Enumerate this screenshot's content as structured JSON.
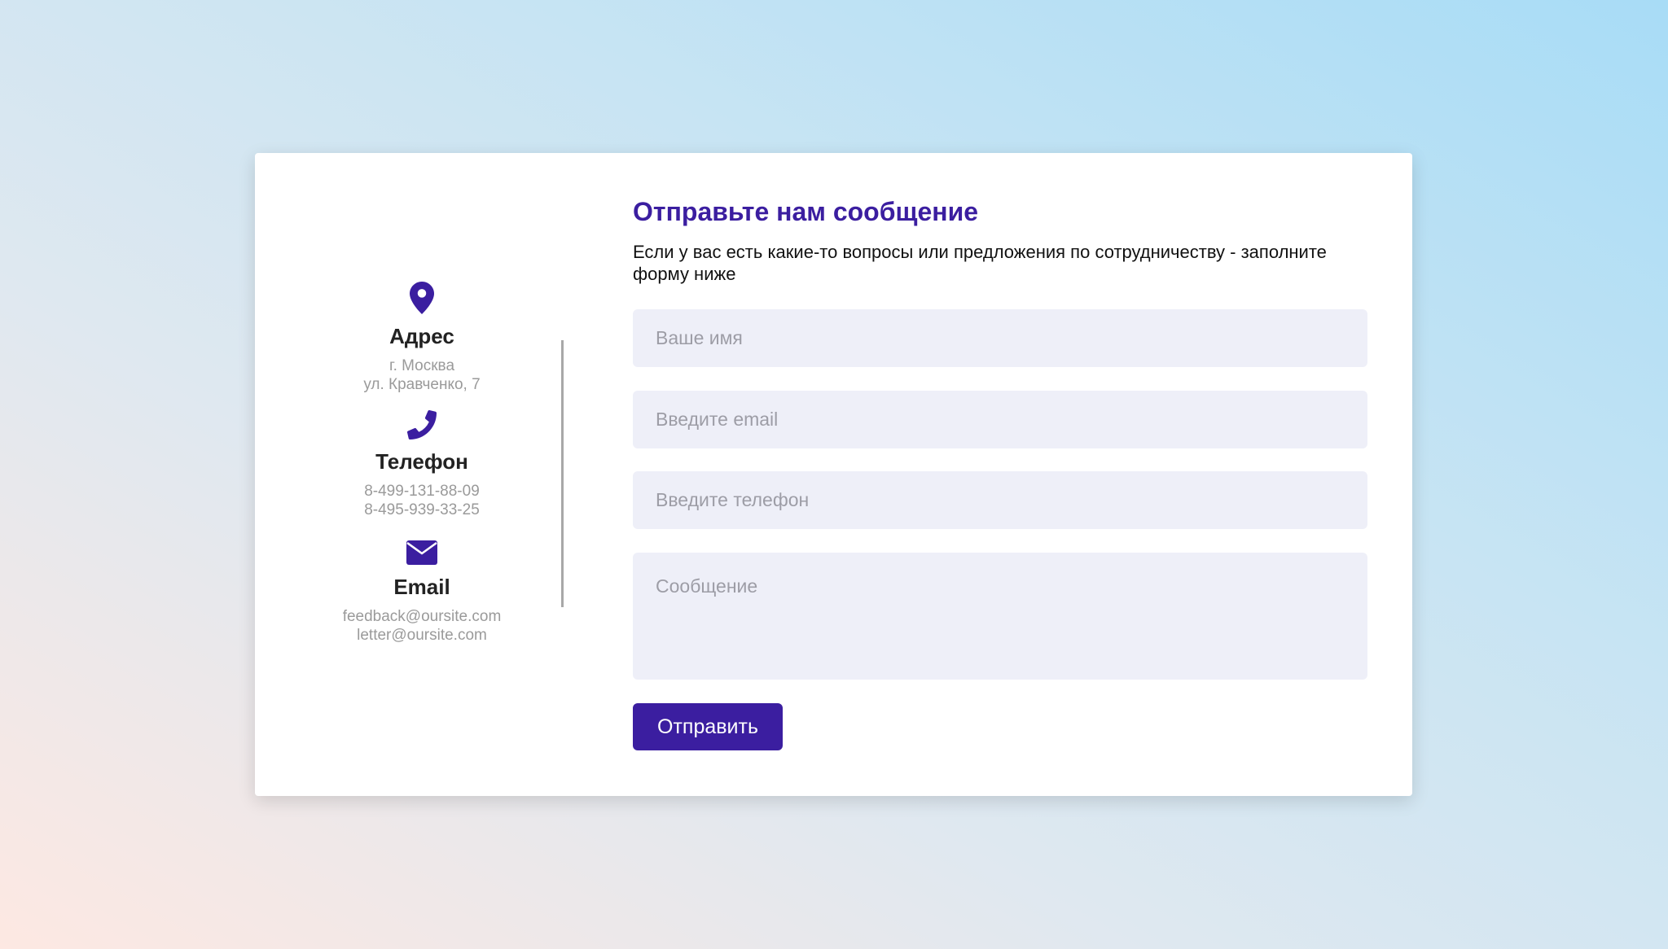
{
  "contacts": {
    "address": {
      "icon": "map-pin-icon",
      "title": "Адрес",
      "lines": [
        "г. Москва",
        "ул. Кравченко, 7"
      ]
    },
    "phone": {
      "icon": "phone-icon",
      "title": "Телефон",
      "lines": [
        "8-499-131-88-09",
        "8-495-939-33-25"
      ]
    },
    "email": {
      "icon": "envelope-icon",
      "title": "Email",
      "lines": [
        "feedback@oursite.com",
        "letter@oursite.com"
      ]
    }
  },
  "form": {
    "title": "Отправьте нам сообщение",
    "description": "Если у вас есть какие-то вопросы или предложения по сотрудничеству - заполните форму ниже",
    "fields": {
      "name": {
        "placeholder": "Ваше имя",
        "value": ""
      },
      "email": {
        "placeholder": "Введите email",
        "value": ""
      },
      "phone": {
        "placeholder": "Введите телефон",
        "value": ""
      },
      "message": {
        "placeholder": "Сообщение",
        "value": ""
      }
    },
    "submit_label": "Отправить"
  },
  "colors": {
    "accent": "#3b1ea0",
    "input_background": "#eeeff8",
    "muted_text": "#9a9a9a"
  }
}
